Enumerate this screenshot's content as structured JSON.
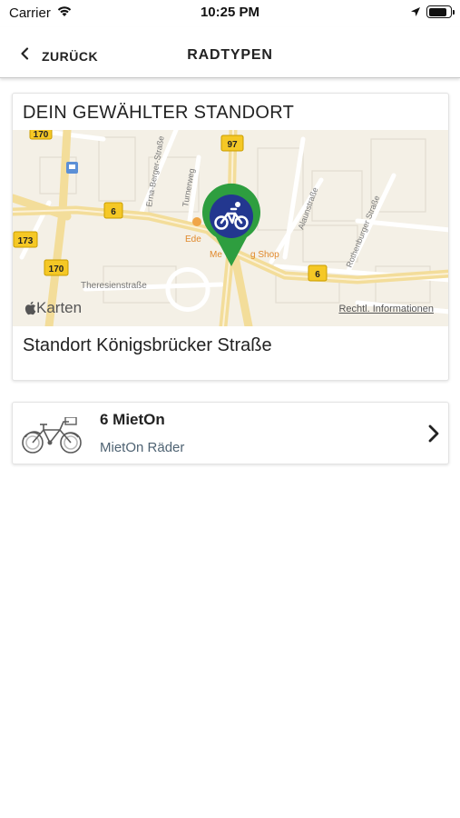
{
  "status_bar": {
    "carrier": "Carrier",
    "time": "10:25 PM",
    "battery_level": 0.9
  },
  "nav": {
    "back_label": "ZURÜCK",
    "title": "RADTYPEN"
  },
  "location_card": {
    "header": "DEIN GEWÄHLTER STANDORT",
    "location_name": "Standort Königsbrücker Straße",
    "map": {
      "brand": "Karten",
      "legal_link": "Rechtl. Informationen",
      "road_badges": [
        "170",
        "97",
        "6",
        "173",
        "170",
        "6"
      ],
      "street_labels": [
        "Erna-Berger-Straße",
        "Turnerweg",
        "Alaunstraße",
        "Rothenburger Straße",
        "Theresienstraße"
      ],
      "poi_labels": [
        "Ede",
        "Me",
        "g Shop"
      ],
      "marker_color": "#2e9e3f",
      "marker_inner_color": "#23378f"
    }
  },
  "bike_list": [
    {
      "title": "6 MietOn",
      "subtitle": "MietOn Räder"
    }
  ]
}
